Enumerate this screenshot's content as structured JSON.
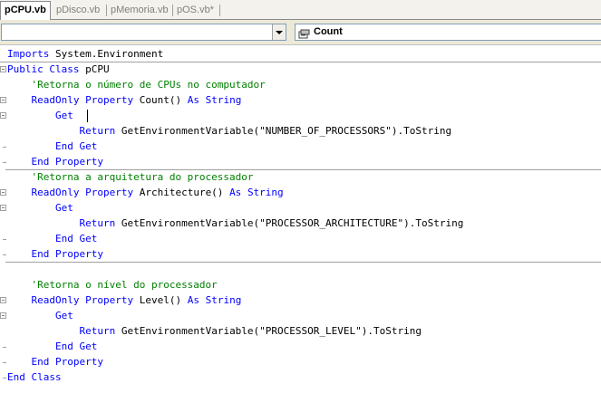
{
  "tabs": [
    {
      "label": "pCPU.vb",
      "active": true
    },
    {
      "label": "pDisco.vb",
      "active": false
    },
    {
      "label": "pMemoria.vb",
      "active": false
    },
    {
      "label": "pOS.vb*",
      "active": false
    }
  ],
  "navbar": {
    "class_combo_value": "",
    "member_combo_value": "Count",
    "member_icon": "property-icon"
  },
  "code_lines": [
    [
      [
        "kw",
        "Imports"
      ],
      [
        "pl",
        " System.Environment"
      ]
    ],
    [
      [
        "kw",
        "Public"
      ],
      [
        "pl",
        " "
      ],
      [
        "kw",
        "Class"
      ],
      [
        "pl",
        " pCPU"
      ]
    ],
    [
      [
        "pl",
        "    "
      ],
      [
        "cm",
        "'Retorna o número de CPUs no computador"
      ]
    ],
    [
      [
        "pl",
        "    "
      ],
      [
        "kw",
        "ReadOnly"
      ],
      [
        "pl",
        " "
      ],
      [
        "kw",
        "Property"
      ],
      [
        "pl",
        " Count() "
      ],
      [
        "kw",
        "As"
      ],
      [
        "pl",
        " "
      ],
      [
        "kw",
        "String"
      ]
    ],
    [
      [
        "pl",
        "        "
      ],
      [
        "kw",
        "Get"
      ]
    ],
    [
      [
        "pl",
        "            "
      ],
      [
        "kw",
        "Return"
      ],
      [
        "pl",
        " GetEnvironmentVariable(\"NUMBER_OF_PROCESSORS\").ToString"
      ]
    ],
    [
      [
        "pl",
        "        "
      ],
      [
        "kw",
        "End"
      ],
      [
        "pl",
        " "
      ],
      [
        "kw",
        "Get"
      ]
    ],
    [
      [
        "pl",
        "    "
      ],
      [
        "kw",
        "End"
      ],
      [
        "pl",
        " "
      ],
      [
        "kw",
        "Property"
      ]
    ],
    [
      [
        "pl",
        "    "
      ],
      [
        "cm",
        "'Retorna a arquitetura do processador"
      ]
    ],
    [
      [
        "pl",
        "    "
      ],
      [
        "kw",
        "ReadOnly"
      ],
      [
        "pl",
        " "
      ],
      [
        "kw",
        "Property"
      ],
      [
        "pl",
        " Architecture() "
      ],
      [
        "kw",
        "As"
      ],
      [
        "pl",
        " "
      ],
      [
        "kw",
        "String"
      ]
    ],
    [
      [
        "pl",
        "        "
      ],
      [
        "kw",
        "Get"
      ]
    ],
    [
      [
        "pl",
        "            "
      ],
      [
        "kw",
        "Return"
      ],
      [
        "pl",
        " GetEnvironmentVariable(\"PROCESSOR_ARCHITECTURE\").ToString"
      ]
    ],
    [
      [
        "pl",
        "        "
      ],
      [
        "kw",
        "End"
      ],
      [
        "pl",
        " "
      ],
      [
        "kw",
        "Get"
      ]
    ],
    [
      [
        "pl",
        "    "
      ],
      [
        "kw",
        "End"
      ],
      [
        "pl",
        " "
      ],
      [
        "kw",
        "Property"
      ]
    ],
    [],
    [
      [
        "pl",
        "    "
      ],
      [
        "cm",
        "'Retorna o nível do processador"
      ]
    ],
    [
      [
        "pl",
        "    "
      ],
      [
        "kw",
        "ReadOnly"
      ],
      [
        "pl",
        " "
      ],
      [
        "kw",
        "Property"
      ],
      [
        "pl",
        " Level() "
      ],
      [
        "kw",
        "As"
      ],
      [
        "pl",
        " "
      ],
      [
        "kw",
        "String"
      ]
    ],
    [
      [
        "pl",
        "        "
      ],
      [
        "kw",
        "Get"
      ]
    ],
    [
      [
        "pl",
        "            "
      ],
      [
        "kw",
        "Return"
      ],
      [
        "pl",
        " GetEnvironmentVariable(\"PROCESSOR_LEVEL\").ToString"
      ]
    ],
    [
      [
        "pl",
        "        "
      ],
      [
        "kw",
        "End"
      ],
      [
        "pl",
        " "
      ],
      [
        "kw",
        "Get"
      ]
    ],
    [
      [
        "pl",
        "    "
      ],
      [
        "kw",
        "End"
      ],
      [
        "pl",
        " "
      ],
      [
        "kw",
        "Property"
      ]
    ],
    [
      [
        "kw",
        "End"
      ],
      [
        "pl",
        " "
      ],
      [
        "kw",
        "Class"
      ]
    ]
  ],
  "colors": {
    "keyword": "#0000ff",
    "comment": "#008000",
    "plain": "#000000"
  }
}
